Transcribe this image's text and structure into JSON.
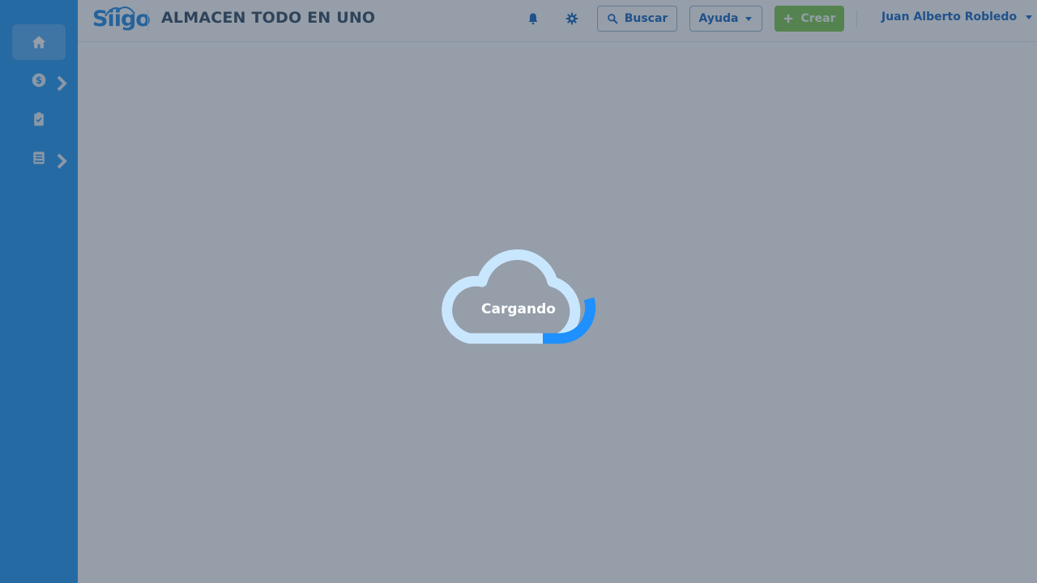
{
  "header": {
    "logo_text": "Siigo",
    "company_name": "ALMACEN TODO EN UNO",
    "search_label": "Buscar",
    "help_label": "Ayuda",
    "create_label": "Crear",
    "user_name": "Juan Alberto Robledo"
  },
  "sidebar": {
    "items": [
      {
        "icon": "home-icon",
        "active": true
      },
      {
        "icon": "dollar-icon",
        "has_submenu": true
      },
      {
        "icon": "clipboard-check-icon"
      },
      {
        "icon": "book-icon",
        "has_submenu": true
      }
    ]
  },
  "loading": {
    "label": "Cargando"
  },
  "colors": {
    "sidebar": "#2196f3",
    "create_button": "#7cc84a",
    "overlay": "rgba(44,62,84,0.5)",
    "cloud_track": "#c9e6ff",
    "cloud_progress": "#1e90ff"
  }
}
